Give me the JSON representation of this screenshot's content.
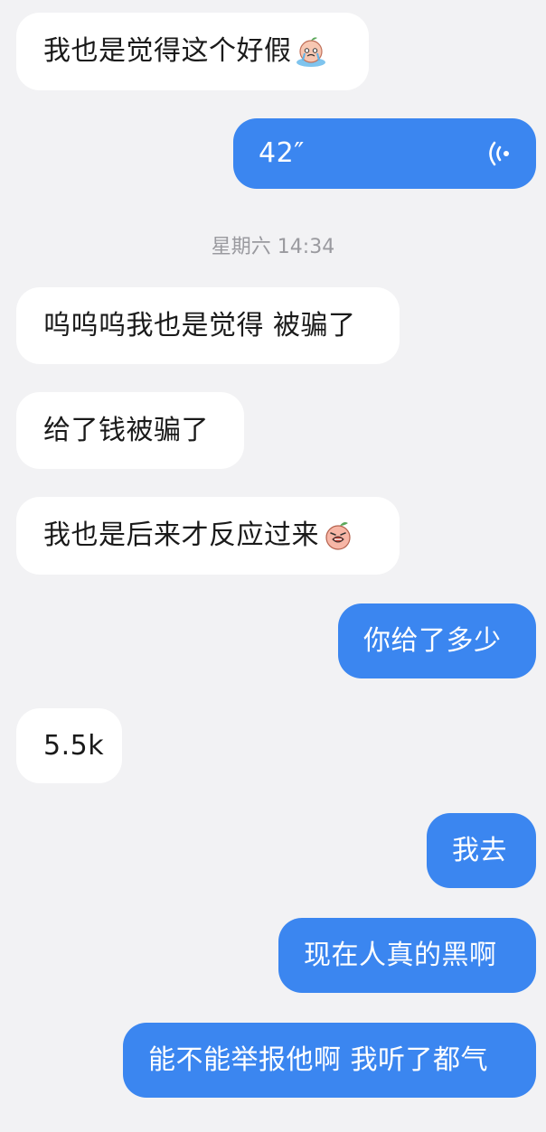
{
  "messages": [
    {
      "side": "in",
      "text": "我也是觉得这个好假",
      "emoji": "crying-peach-emoji"
    },
    {
      "side": "out",
      "type": "voice",
      "duration": "42″"
    },
    {
      "side": "in",
      "text": "呜呜呜我也是觉得 被骗了"
    },
    {
      "side": "in",
      "text": "给了钱被骗了"
    },
    {
      "side": "in",
      "text": "我也是后来才反应过来",
      "emoji": "upset-peach-emoji"
    },
    {
      "side": "out",
      "text": "你给了多少"
    },
    {
      "side": "in",
      "text": "5.5k"
    },
    {
      "side": "out",
      "text": "我去"
    },
    {
      "side": "out",
      "text": "现在人真的黑啊"
    },
    {
      "side": "out",
      "text": "能不能举报他啊 我听了都气"
    }
  ],
  "timestamp": "星期六 14:34",
  "colors": {
    "background": "#f2f2f4",
    "incoming_bubble": "#ffffff",
    "outgoing_bubble": "#3b86f0",
    "timestamp_text": "#9a9a9f"
  }
}
